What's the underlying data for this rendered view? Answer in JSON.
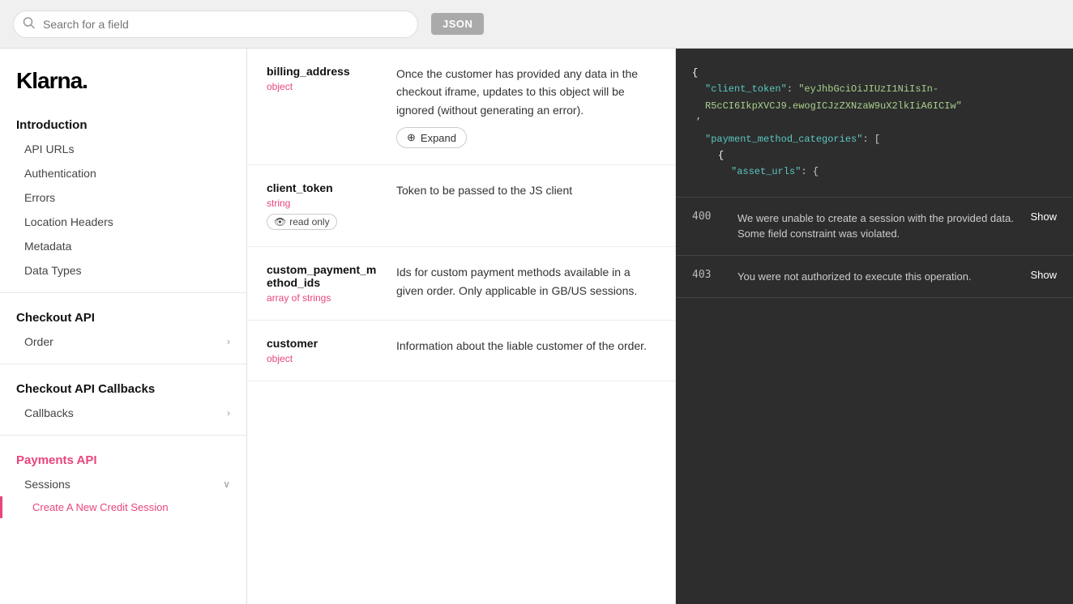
{
  "topbar": {
    "search_placeholder": "Search for a field",
    "json_button_label": "JSON"
  },
  "sidebar": {
    "logo": "Klarna.",
    "sections": [
      {
        "title": "Introduction",
        "items": [
          {
            "label": "API URLs",
            "sub": false,
            "active": false
          },
          {
            "label": "Authentication",
            "sub": false,
            "active": false
          },
          {
            "label": "Errors",
            "sub": false,
            "active": false
          },
          {
            "label": "Location Headers",
            "sub": false,
            "active": false
          },
          {
            "label": "Metadata",
            "sub": false,
            "active": false
          },
          {
            "label": "Data Types",
            "sub": false,
            "active": false
          }
        ]
      },
      {
        "title": "Checkout API",
        "items": [
          {
            "label": "Order",
            "sub": false,
            "active": false,
            "chevron": ">"
          }
        ]
      },
      {
        "title": "Checkout API Callbacks",
        "items": [
          {
            "label": "Callbacks",
            "sub": false,
            "active": false,
            "chevron": ">"
          }
        ]
      },
      {
        "title": "Payments API",
        "items": [
          {
            "label": "Sessions",
            "sub": false,
            "active": false,
            "chevron": "v"
          },
          {
            "label": "Create A New Credit Session",
            "sub": true,
            "active": true
          }
        ]
      }
    ]
  },
  "fields": [
    {
      "name": "billing_address",
      "type": "object",
      "badge": null,
      "description": "Once the customer has provided any data in the checkout iframe, updates to this object will be ignored (without generating an error).",
      "expand": true
    },
    {
      "name": "client_token",
      "type": "string",
      "badge": "read only",
      "description": "Token to be passed to the JS client",
      "expand": false
    },
    {
      "name": "custom_payment_method_ids",
      "type": "array of strings",
      "badge": null,
      "description": "Ids for custom payment methods available in a given order. Only applicable in GB/US sessions.",
      "expand": false
    },
    {
      "name": "customer",
      "type": "object",
      "badge": null,
      "description": "Information about the liable customer of the order.",
      "expand": false
    }
  ],
  "code_block": {
    "lines": [
      {
        "text": "{",
        "type": "brace"
      },
      {
        "text": "  \"client_token\": \"eyJhbGciOiJIUzI1NiIsIn-R5cCI6IkpXVCJ9.ewogICJzZXNzaW9uX2lkIiA6ICIw\"",
        "type": "key-string"
      },
      {
        "text": "  \"payment_method_categories\": [",
        "type": "key-array"
      },
      {
        "text": "    {",
        "type": "brace"
      },
      {
        "text": "      \"asset_urls\": {",
        "type": "key"
      }
    ]
  },
  "responses": [
    {
      "code": "400",
      "description": "We were unable to create a session with the provided data. Some field constraint was violated.",
      "show_label": "Show"
    },
    {
      "code": "403",
      "description": "You were not authorized to execute this operation.",
      "show_label": "Show"
    }
  ],
  "icons": {
    "search": "🔍",
    "expand": "⊕",
    "eye": "👁",
    "chevron_right": ">",
    "chevron_down": "∨"
  }
}
